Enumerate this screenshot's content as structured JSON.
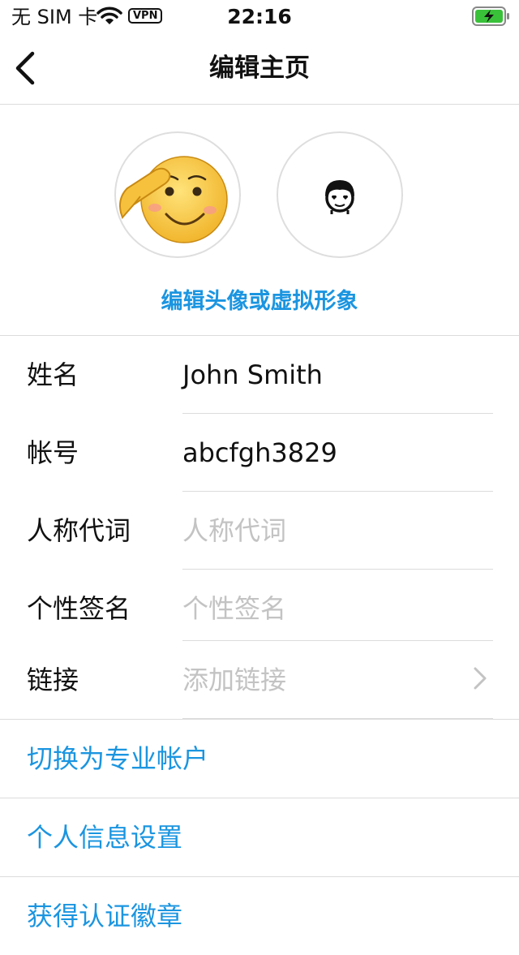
{
  "status_bar": {
    "carrier": "无 SIM 卡",
    "vpn": "VPN",
    "time": "22:16",
    "battery_color": "#3ac13a"
  },
  "nav": {
    "title": "编辑主页",
    "back_icon": "chevron-left-icon"
  },
  "avatar": {
    "edit_label": "编辑头像或虚拟形象",
    "photo_icon": "salute-emoji",
    "avatar_icon": "avatar-face-icon"
  },
  "fields": [
    {
      "label": "姓名",
      "value": "John Smith",
      "placeholder": ""
    },
    {
      "label": "帐号",
      "value": "abcfgh3829",
      "placeholder": ""
    },
    {
      "label": "人称代词",
      "value": "",
      "placeholder": "人称代词"
    },
    {
      "label": "个性签名",
      "value": "",
      "placeholder": "个性签名"
    },
    {
      "label": "链接",
      "value": "",
      "placeholder": "添加链接"
    }
  ],
  "links": [
    {
      "label": "切换为专业帐户"
    },
    {
      "label": "个人信息设置"
    },
    {
      "label": "获得认证徽章"
    }
  ],
  "colors": {
    "accent": "#1b95e0",
    "placeholder": "#c3c3c3",
    "divider": "#dcdcdc"
  }
}
